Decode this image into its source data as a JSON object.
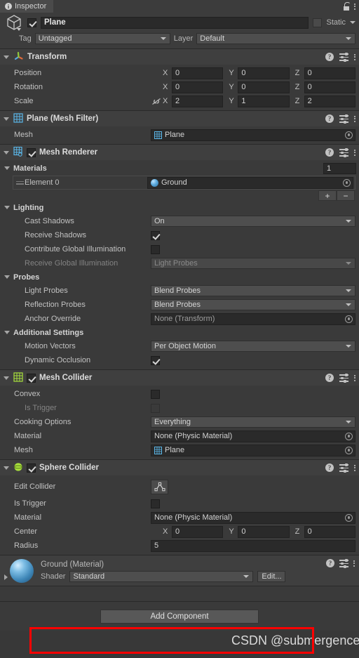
{
  "tab": {
    "label": "Inspector",
    "info_icon": "info-icon",
    "lock_icon": "lock-icon",
    "menu_icon": "kebab-menu-icon"
  },
  "object_header": {
    "enabled": true,
    "name": "Plane",
    "static_label": "Static",
    "static_checked": false,
    "tag_label": "Tag",
    "tag_value": "Untagged",
    "layer_label": "Layer",
    "layer_value": "Default"
  },
  "components": [
    {
      "title": "Transform",
      "icon": "transform-axis-icon",
      "rows": [
        {
          "label": "Position",
          "x": "0",
          "y": "0",
          "z": "0"
        },
        {
          "label": "Rotation",
          "x": "0",
          "y": "0",
          "z": "0"
        },
        {
          "label": "Scale",
          "x": "2",
          "y": "1",
          "z": "2"
        }
      ]
    },
    {
      "title": "Plane (Mesh Filter)",
      "icon": "mesh-filter-grid-icon",
      "mesh_label": "Mesh",
      "mesh_value": "Plane"
    },
    {
      "title": "Mesh Renderer",
      "icon": "mesh-renderer-grid-icon",
      "enabled": true,
      "materials_label": "Materials",
      "materials_count": "1",
      "element_label": "Element 0",
      "element_value": "Ground",
      "add_label": "+",
      "remove_label": "−",
      "lighting_label": "Lighting",
      "cast_shadows_label": "Cast Shadows",
      "cast_shadows_value": "On",
      "receive_shadows_label": "Receive Shadows",
      "receive_shadows_checked": true,
      "contribute_gi_label": "Contribute Global Illumination",
      "contribute_gi_checked": false,
      "receive_gi_label": "Receive Global Illumination",
      "receive_gi_value": "Light Probes",
      "probes_label": "Probes",
      "light_probes_label": "Light Probes",
      "light_probes_value": "Blend Probes",
      "reflection_probes_label": "Reflection Probes",
      "reflection_probes_value": "Blend Probes",
      "anchor_override_label": "Anchor Override",
      "anchor_override_value": "None (Transform)",
      "additional_label": "Additional Settings",
      "motion_vectors_label": "Motion Vectors",
      "motion_vectors_value": "Per Object Motion",
      "dynamic_occlusion_label": "Dynamic Occlusion",
      "dynamic_occlusion_checked": true
    },
    {
      "title": "Mesh Collider",
      "icon": "mesh-collider-grid-icon",
      "enabled": true,
      "convex_label": "Convex",
      "convex_checked": false,
      "is_trigger_label": "Is Trigger",
      "is_trigger_checked": false,
      "cooking_options_label": "Cooking Options",
      "cooking_options_value": "Everything",
      "material_label": "Material",
      "material_value": "None (Physic Material)",
      "mesh_label": "Mesh",
      "mesh_value": "Plane"
    },
    {
      "title": "Sphere Collider",
      "icon": "sphere-collider-icon",
      "enabled": true,
      "edit_collider_label": "Edit Collider",
      "edit_collider_icon": "edit-collider-icon",
      "is_trigger_label": "Is Trigger",
      "is_trigger_checked": false,
      "material_label": "Material",
      "material_value": "None (Physic Material)",
      "center_label": "Center",
      "center_x": "0",
      "center_y": "0",
      "center_z": "0",
      "radius_label": "Radius",
      "radius_value": "5"
    }
  ],
  "material_footer": {
    "title": "Ground (Material)",
    "shader_label": "Shader",
    "shader_value": "Standard",
    "edit_label": "Edit..."
  },
  "add_component": {
    "label": "Add Component"
  },
  "watermark": {
    "text": "CSDN @submergence"
  },
  "colors": {
    "panel_bg": "#383838",
    "header_bg": "#3c3c3c",
    "component_header_bg": "#3f3f3f",
    "field_bg": "#2a2a2a",
    "dropdown_bg": "#4e4e4e",
    "text": "#c2c2c2",
    "accent_red": "#ff0000",
    "mesh_icon_blue": "#5ab6e8",
    "collider_icon_green": "#a8e03c"
  }
}
